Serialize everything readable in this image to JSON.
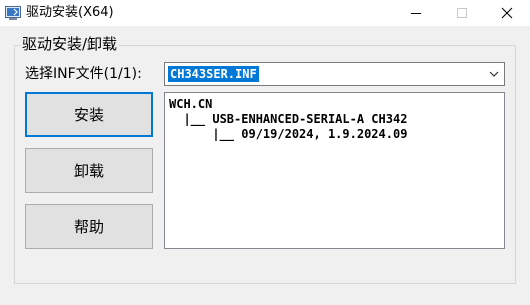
{
  "window": {
    "title": "驱动安装(X64)",
    "controls": {
      "minimize_icon": "minimize-icon",
      "maximize_icon": "maximize-icon",
      "close_icon": "close-icon"
    }
  },
  "group": {
    "label": "驱动安装/卸载"
  },
  "inf_select": {
    "label": "选择INF文件(1/1):",
    "selected_value": "CH343SER.INF"
  },
  "buttons": {
    "install": "安装",
    "uninstall": "卸载",
    "help": "帮助"
  },
  "info": {
    "lines": [
      "WCH.CN",
      "  |__ USB-ENHANCED-SERIAL-A CH342",
      "      |__ 09/19/2024, 1.9.2024.09"
    ]
  },
  "colors": {
    "accent": "#0078d7",
    "window_bg": "#f0f0f0",
    "button_bg": "#e1e1e1"
  }
}
